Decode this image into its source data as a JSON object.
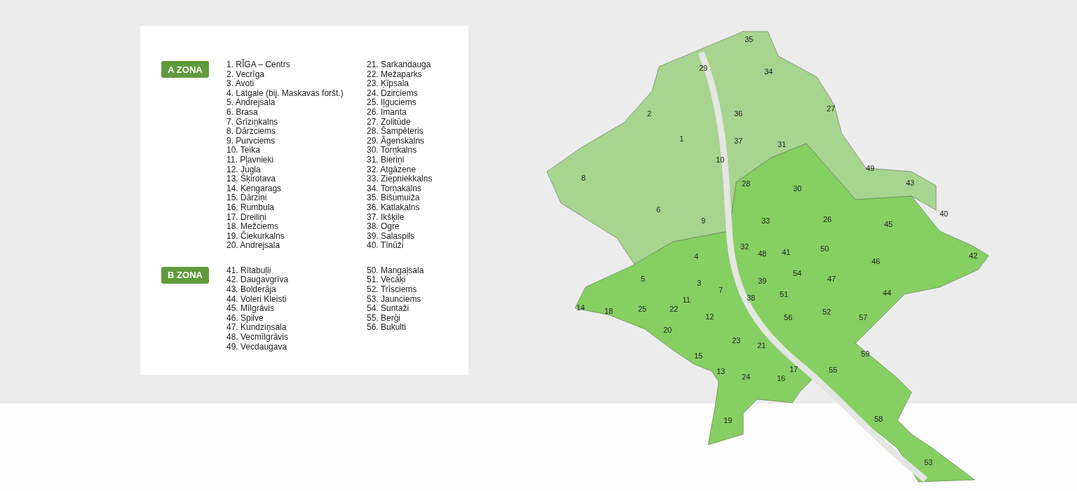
{
  "legend": {
    "zones": [
      {
        "badge": "A ZONA",
        "columns": [
          [
            "1. RĪGA – Centrs",
            "2. Vecrīga",
            "3. Avoti",
            "4. Latgale (bij. Maskavas foršt.)",
            "5. Andrejsala",
            "6. Brasa",
            "7. Grīziņkalns",
            "8. Dārzciems",
            "9. Purvciems",
            "10. Teika",
            "11. Pļavnieki",
            "12. Jugla",
            "13. Šķirotava",
            "14. Ķengarags",
            "15. Dārziņi",
            "16. Rumbula",
            "17. Dreiliņi",
            "18. Mežciems",
            "19. Čiekurkalns",
            "20. Andrejsala"
          ],
          [
            "21. Sarkandauga",
            "22. Mežaparks",
            "23. Ķīpsala",
            "24. Dzirciems",
            "25. Iļguciems",
            "26. Imanta",
            "27. Zolitūde",
            "28. Šampēteris",
            "29. Āgenskalns",
            "30. Torņkalns",
            "31. Bieriņi",
            "32. Atgāzene",
            "33. Ziepniekkalns",
            "34. Torņakalns",
            "35. Bišumuiža",
            "36. Katlakalns",
            "37. Ikšķile",
            "38. Ogre",
            "39. Salaspils",
            "40. Tīnūži"
          ]
        ]
      },
      {
        "badge": "B ZONA",
        "columns": [
          [
            "41. Rītabuļli",
            "42. Daugavgrīva",
            "43. Bolderāja",
            "44. Voleri Kleisti",
            "45. Mīlgrāvis",
            "46. Spilve",
            "47. Kundziņsala",
            "48. Vecmīlgrāvis",
            "49. Vecdaugava"
          ],
          [
            "50. Mangaļsala",
            "51. Vecāķi",
            "52. Trīsciems",
            "53. Jaunciems",
            "54. Suntaži",
            "55. Berģi",
            "56. Bukulti"
          ]
        ]
      }
    ]
  },
  "map": {
    "zone_labels": [
      "35",
      "29",
      "34",
      "2",
      "36",
      "37",
      "27",
      "1",
      "31",
      "10",
      "49",
      "43",
      "8",
      "28",
      "30",
      "6",
      "9",
      "40",
      "33",
      "26",
      "45",
      "32",
      "48",
      "41",
      "50",
      "4",
      "42",
      "46",
      "54",
      "5",
      "3",
      "39",
      "47",
      "7",
      "51",
      "44",
      "11",
      "38",
      "14",
      "18",
      "25",
      "22",
      "12",
      "56",
      "52",
      "57",
      "20",
      "23",
      "21",
      "59",
      "15",
      "13",
      "24",
      "16",
      "17",
      "55",
      "19",
      "58",
      "53"
    ]
  }
}
